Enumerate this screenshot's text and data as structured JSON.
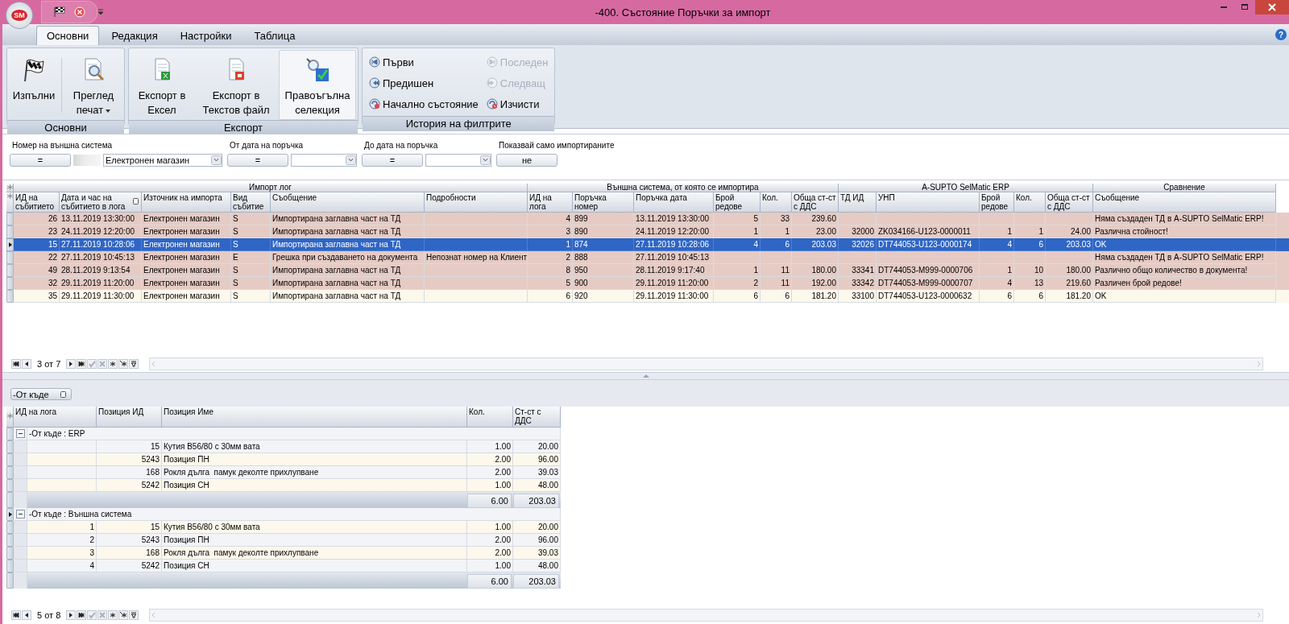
{
  "window": {
    "title": "-400. Състояние Поръчки за импорт",
    "logo": "SM",
    "help": "?"
  },
  "tabs": [
    {
      "label": "Основни",
      "selected": true
    },
    {
      "label": "Редакция",
      "selected": false
    },
    {
      "label": "Настройки",
      "selected": false
    },
    {
      "label": "Таблица",
      "selected": false
    }
  ],
  "ribbon": {
    "groups": [
      {
        "title": "Основни",
        "kind": "big",
        "buttons": [
          {
            "label": "Изпълни",
            "dropdown": false,
            "selected": false
          },
          {
            "label": "Преглед печат",
            "dropdown": true,
            "selected": false
          }
        ]
      },
      {
        "title": "Експорт",
        "kind": "big",
        "buttons": [
          {
            "label": "Експорт в Ексел",
            "dropdown": false,
            "selected": false
          },
          {
            "label": "Експорт в Текстов файл",
            "dropdown": false,
            "selected": false
          },
          {
            "label": "Правоъгълна селекция",
            "dropdown": false,
            "selected": true
          }
        ]
      },
      {
        "title": "История на филтрите",
        "kind": "small",
        "buttons": [
          {
            "label": "Първи",
            "disabled": false
          },
          {
            "label": "Предишен",
            "disabled": false
          },
          {
            "label": "Начално състояние",
            "disabled": false
          },
          {
            "label": "Последен",
            "disabled": true
          },
          {
            "label": "Следващ",
            "disabled": true
          },
          {
            "label": "Изчисти",
            "disabled": false
          }
        ]
      }
    ]
  },
  "filters": [
    {
      "label": "Номер на външна система",
      "kind": "redacted-combo",
      "operator": "=",
      "value": "Електронен магазин"
    },
    {
      "label": "От дата на поръчка",
      "kind": "date",
      "operator": "="
    },
    {
      "label": "До дата на поръчка",
      "kind": "date",
      "operator": "="
    },
    {
      "label": "Показвай само импортираните",
      "kind": "toggle",
      "value": "не"
    }
  ],
  "main_grid": {
    "column_groups": [
      {
        "label": "Импорт лог"
      },
      {
        "label": "Външна система, от която се импортира"
      },
      {
        "label": "A-SUPTO SelMatic ERP"
      },
      {
        "label": "Сравнение"
      }
    ],
    "columns": [
      {
        "label": "ИД на събитието",
        "sorted": false
      },
      {
        "label": "Дата и час на събитието в лога",
        "sorted": true
      },
      {
        "label": "Източник на импорта",
        "sorted": false
      },
      {
        "label": "Вид събитие",
        "sorted": false
      },
      {
        "label": "Съобщение",
        "sorted": false
      },
      {
        "label": "Подробности",
        "sorted": false
      },
      {
        "label": "ИД на лога",
        "sorted": false
      },
      {
        "label": "Поръчка номер",
        "sorted": false
      },
      {
        "label": "Поръчка дата",
        "sorted": false
      },
      {
        "label": "Брой редове",
        "sorted": false
      },
      {
        "label": "Кол.",
        "sorted": false
      },
      {
        "label": "Обща ст-ст с ДДС",
        "sorted": false
      },
      {
        "label": "ТД ИД",
        "sorted": false
      },
      {
        "label": "УНП",
        "sorted": false
      },
      {
        "label": "Брой редове",
        "sorted": false
      },
      {
        "label": "Кол.",
        "sorted": false
      },
      {
        "label": "Обща ст-ст с ДДС",
        "sorted": false
      },
      {
        "label": "Съобщение",
        "sorted": false
      }
    ],
    "rows": [
      {
        "selected": false,
        "highlighted": true,
        "cells": [
          "26",
          "13.11.2019 13:30:00",
          "Електронен магазин",
          "S",
          "Импортирана заглавна част на ТД",
          null,
          "4",
          "899",
          "13.11.2019 13:30:00",
          "5",
          "33",
          "239.60",
          null,
          null,
          null,
          null,
          null,
          "Няма създаден ТД в A-SUPTO SelMatic ERP!"
        ]
      },
      {
        "selected": false,
        "highlighted": true,
        "cells": [
          "23",
          "24.11.2019 12:20:00",
          "Електронен магазин",
          "S",
          "Импортирана заглавна част на ТД",
          null,
          "3",
          "890",
          "24.11.2019 12:20:00",
          "1",
          "1",
          "23.00",
          "32000",
          "ZK034166-U123-0000011",
          "1",
          "1",
          "24.00",
          "Различна стойност!"
        ]
      },
      {
        "selected": true,
        "highlighted": false,
        "cells": [
          "15",
          "27.11.2019 10:28:06",
          "Електронен магазин",
          "S",
          "Импортирана заглавна част на ТД",
          null,
          "1",
          "874",
          "27.11.2019 10:28:06",
          "4",
          "6",
          "203.03",
          "32026",
          "DT744053-U123-0000174",
          "4",
          "6",
          "203.03",
          "OK"
        ]
      },
      {
        "selected": false,
        "highlighted": true,
        "cells": [
          "22",
          "27.11.2019 10:45:13",
          "Електронен магазин",
          "E",
          "Грешка при създаването на документа",
          "Непознат номер на Клиент",
          "2",
          "888",
          "27.11.2019 10:45:13",
          null,
          null,
          null,
          null,
          null,
          null,
          null,
          null,
          "Няма създаден ТД в A-SUPTO SelMatic ERP!"
        ]
      },
      {
        "selected": false,
        "highlighted": true,
        "cells": [
          "49",
          "28.11.2019 9:13:54",
          "Електронен магазин",
          "S",
          "Импортирана заглавна част на ТД",
          null,
          "8",
          "950",
          "28.11.2019 9:17:40",
          "1",
          "11",
          "180.00",
          "33341",
          "DT744053-M999-0000706",
          "1",
          "10",
          "180.00",
          "Различно общо количество в документа!"
        ]
      },
      {
        "selected": false,
        "highlighted": true,
        "cells": [
          "32",
          "29.11.2019 11:20:00",
          "Електронен магазин",
          "S",
          "Импортирана заглавна част на ТД",
          null,
          "5",
          "900",
          "29.11.2019 11:20:00",
          "2",
          "11",
          "192.00",
          "33342",
          "DT744053-M999-0000707",
          "4",
          "13",
          "219.60",
          "Различен брой редове!"
        ]
      },
      {
        "selected": false,
        "highlighted": false,
        "cells": [
          "35",
          "29.11.2019 11:30:00",
          "Електронен магазин",
          "S",
          "Импортирана заглавна част на ТД",
          null,
          "6",
          "920",
          "29.11.2019 11:30:00",
          "6",
          "6",
          "181.20",
          "33100",
          "DT744053-U123-0000632",
          "6",
          "6",
          "181.20",
          "OK"
        ]
      }
    ],
    "nav": {
      "position": "3 от 7"
    }
  },
  "detail_grid": {
    "group_by": "-От къде",
    "columns": [
      "ИД на лога",
      "Позиция ИД",
      "Позиция Име",
      "Кол.",
      "Ст-ст с ДДС"
    ],
    "groups": [
      {
        "label": "-От къде : ERP",
        "expanded": true,
        "selected": false,
        "totals": [
          "6.00",
          "203.03"
        ],
        "rows": [
          {
            "cells": [
              null,
              "15",
              "Кутия В56/80 с 30мм вата",
              "1.00",
              "20.00"
            ]
          },
          {
            "cells": [
              null,
              "5243",
              "Позиция ПН",
              "2.00",
              "96.00"
            ]
          },
          {
            "cells": [
              null,
              "168",
              "Рокля дълга  памук деколте прихлупване",
              "2.00",
              "39.03"
            ]
          },
          {
            "cells": [
              null,
              "5242",
              "Позиция СН",
              "1.00",
              "48.00"
            ]
          }
        ]
      },
      {
        "label": "-От къде : Външна система",
        "expanded": true,
        "selected": true,
        "totals": [
          "6.00",
          "203.03"
        ],
        "rows": [
          {
            "cells": [
              "1",
              "15",
              "Кутия В56/80 с 30мм вата",
              "1.00",
              "20.00"
            ]
          },
          {
            "cells": [
              "2",
              "5243",
              "Позиция ПН",
              "2.00",
              "96.00"
            ]
          },
          {
            "cells": [
              "3",
              "168",
              "Рокля дълга  памук деколте прихлупване",
              "2.00",
              "39.03"
            ]
          },
          {
            "cells": [
              "4",
              "5242",
              "Позиция СН",
              "1.00",
              "48.00"
            ]
          }
        ]
      }
    ],
    "nav": {
      "position": "5 от 8"
    }
  }
}
